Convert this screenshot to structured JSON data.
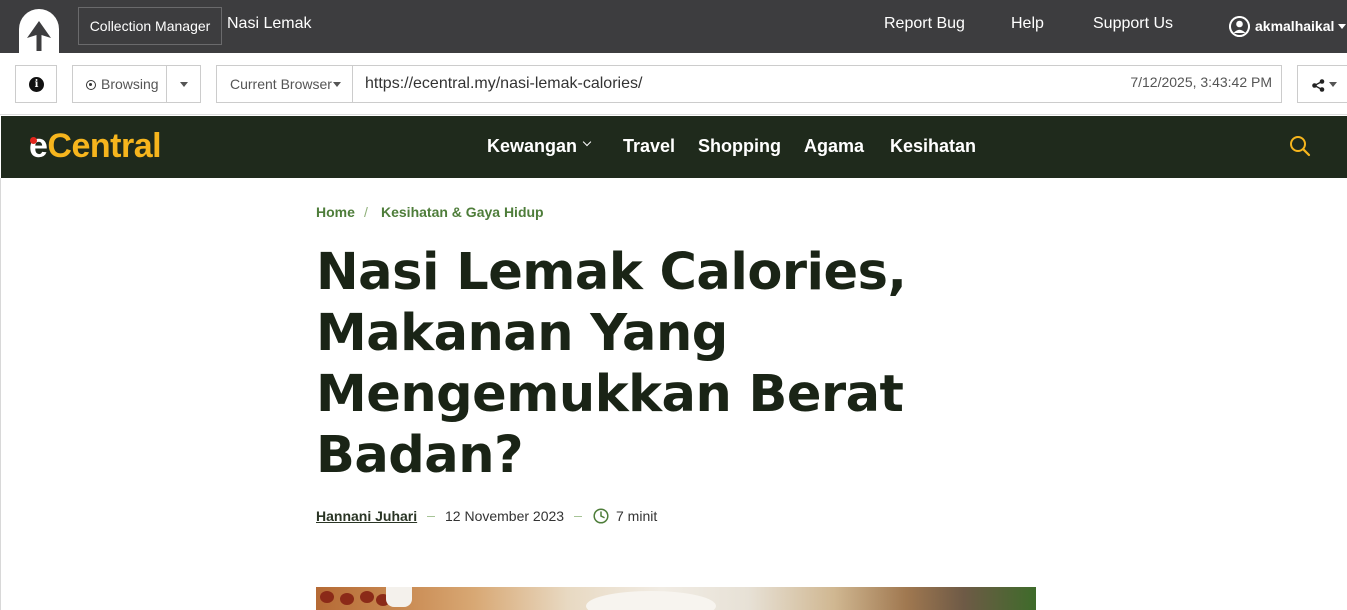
{
  "app": {
    "collection_button": "Collection Manager",
    "collection_name": "Nasi Lemak",
    "links": [
      "Report Bug",
      "Help",
      "Support Us"
    ],
    "username": "akmalhaikal"
  },
  "toolbar": {
    "mode_label": "Browsing",
    "browser_label": "Current Browser",
    "url": "https://ecentral.my/nasi-lemak-calories/",
    "timestamp": "7/12/2025, 3:43:42 PM"
  },
  "site": {
    "brand_first": "e",
    "brand_rest": "Central",
    "nav": [
      "Kewangan",
      "Travel",
      "Shopping",
      "Agama",
      "Kesihatan"
    ],
    "colors": {
      "header_bg": "#1f2a1c",
      "brand_yellow": "#f6b51d",
      "brand_red": "#e2261c",
      "accent_green": "#4e7d3a"
    }
  },
  "article": {
    "breadcrumb": [
      "Home",
      "Kesihatan & Gaya Hidup"
    ],
    "breadcrumb_sep": "/",
    "title_lines": [
      "Nasi Lemak Calories,",
      "Makanan Yang",
      "Mengemukkan Berat",
      "Badan?"
    ],
    "author": "Hannani Juhari",
    "date": "12 November 2023",
    "read_time": "7 minit"
  },
  "icons": {
    "app_logo": "arrow-up-tree-icon",
    "user": "user-circle-icon",
    "info": "info-icon",
    "record": "record-icon",
    "share": "share-icon",
    "search": "search-icon",
    "clock": "clock-icon"
  }
}
